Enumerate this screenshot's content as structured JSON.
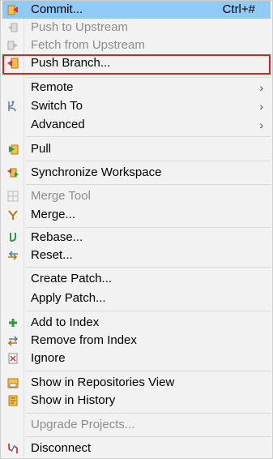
{
  "menu": {
    "commit": {
      "label": "Commit...",
      "shortcut": "Ctrl+#"
    },
    "push_upstream": {
      "label": "Push to Upstream"
    },
    "fetch_upstream": {
      "label": "Fetch from Upstream"
    },
    "push_branch": {
      "label": "Push Branch..."
    },
    "remote": {
      "label": "Remote"
    },
    "switch_to": {
      "label": "Switch To"
    },
    "advanced": {
      "label": "Advanced"
    },
    "pull": {
      "label": "Pull"
    },
    "synchronize": {
      "label": "Synchronize Workspace"
    },
    "merge_tool": {
      "label": "Merge Tool"
    },
    "merge": {
      "label": "Merge..."
    },
    "rebase": {
      "label": "Rebase..."
    },
    "reset": {
      "label": "Reset..."
    },
    "create_patch": {
      "label": "Create Patch..."
    },
    "apply_patch": {
      "label": "Apply Patch..."
    },
    "add_index": {
      "label": "Add to Index"
    },
    "remove_index": {
      "label": "Remove from Index"
    },
    "ignore": {
      "label": "Ignore"
    },
    "show_repos": {
      "label": "Show in Repositories View"
    },
    "show_history": {
      "label": "Show in History"
    },
    "upgrade": {
      "label": "Upgrade Projects..."
    },
    "disconnect": {
      "label": "Disconnect"
    },
    "submenu_arrow": "›"
  },
  "colors": {
    "highlight": "#91c9f7",
    "outline": "#e01e24",
    "disabled_text": "#8c8c8c"
  }
}
